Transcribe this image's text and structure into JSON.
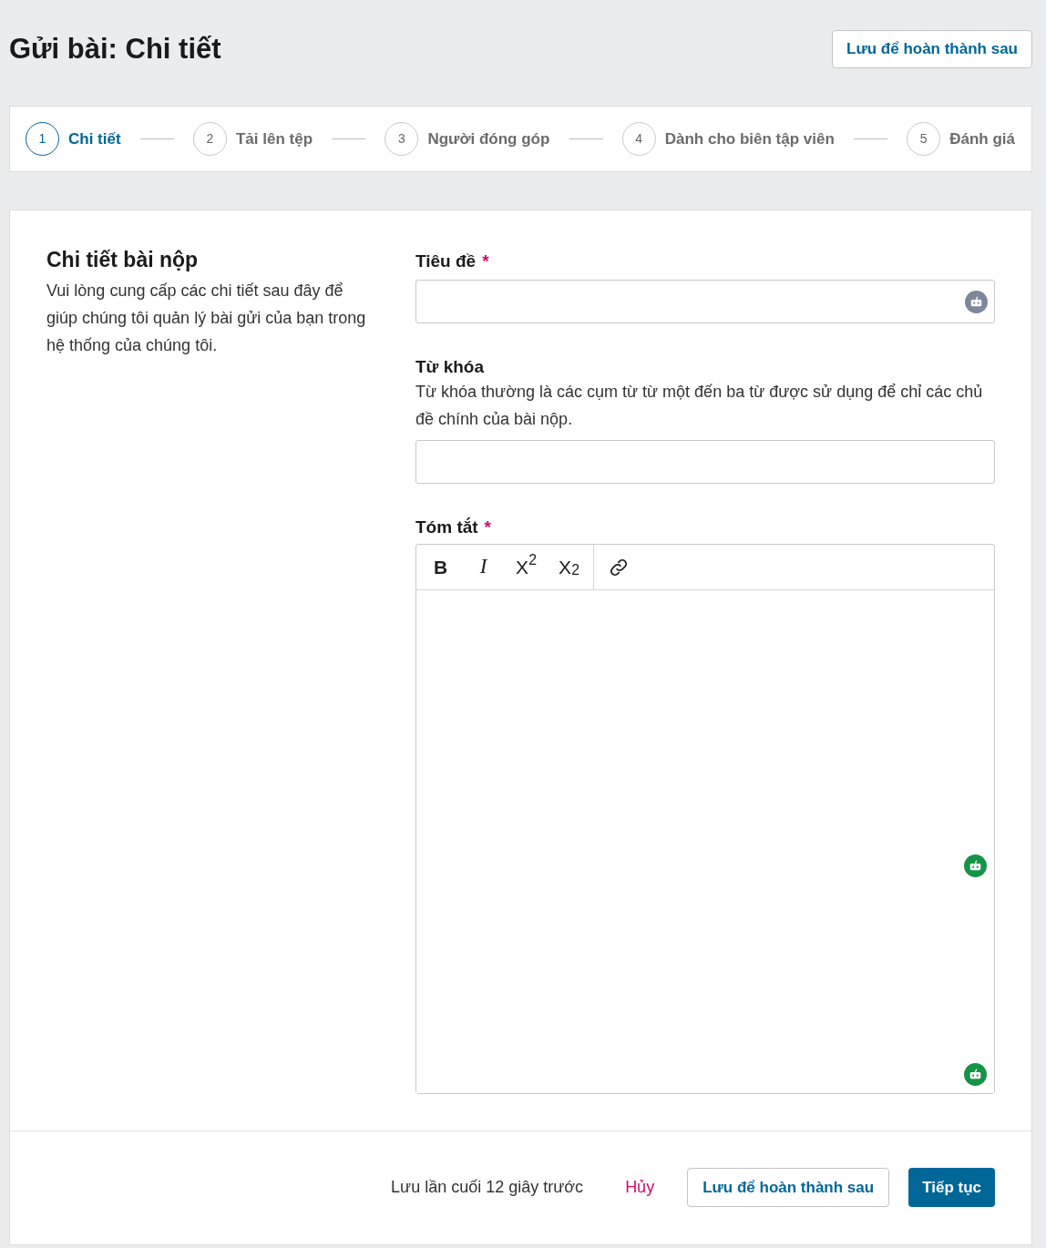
{
  "header": {
    "title": "Gửi bài: Chi tiết",
    "save_button": "Lưu để hoàn thành sau"
  },
  "steps": [
    {
      "number": "1",
      "label": "Chi tiết",
      "selected": true
    },
    {
      "number": "2",
      "label": "Tải lên tệp",
      "selected": false
    },
    {
      "number": "3",
      "label": "Người đóng góp",
      "selected": false
    },
    {
      "number": "4",
      "label": "Dành cho biên tập viên",
      "selected": false
    },
    {
      "number": "5",
      "label": "Đánh giá",
      "selected": false
    }
  ],
  "section": {
    "heading": "Chi tiết bài nộp",
    "description": "Vui lòng cung cấp các chi tiết sau đây để giúp chúng tôi quản lý bài gửi của bạn trong hệ thống của chúng tôi."
  },
  "fields": [
    {
      "kind": "text",
      "label": "Tiêu đề",
      "required_mark": "*",
      "assistant_icons": [
        {
          "active": false
        }
      ]
    },
    {
      "kind": "text",
      "label": "Từ khóa",
      "description": "Từ khóa thường là các cụm từ từ một đến ba từ được sử dụng để chỉ các chủ đề chính của bài nộp."
    },
    {
      "kind": "rich_text",
      "label": "Tóm tắt",
      "required_mark": "*",
      "toolbar": {
        "groups": [
          [
            {
              "kind": "bold",
              "label": "B"
            },
            {
              "kind": "italic",
              "label": "I"
            },
            {
              "kind": "superscript",
              "label": "X$^{2}$"
            },
            {
              "kind": "subscript",
              "label": "X$_{2}$"
            }
          ],
          [
            {
              "kind": "link"
            }
          ]
        ]
      },
      "assistant_icons": [
        {
          "active": true
        },
        {
          "active": true
        }
      ]
    }
  ],
  "footer": {
    "status": "Lưu lần cuối 12 giây trước",
    "cancel_link": "Hủy",
    "save_button": "Lưu để hoàn thành sau",
    "continue_button": "Tiếp tục"
  }
}
